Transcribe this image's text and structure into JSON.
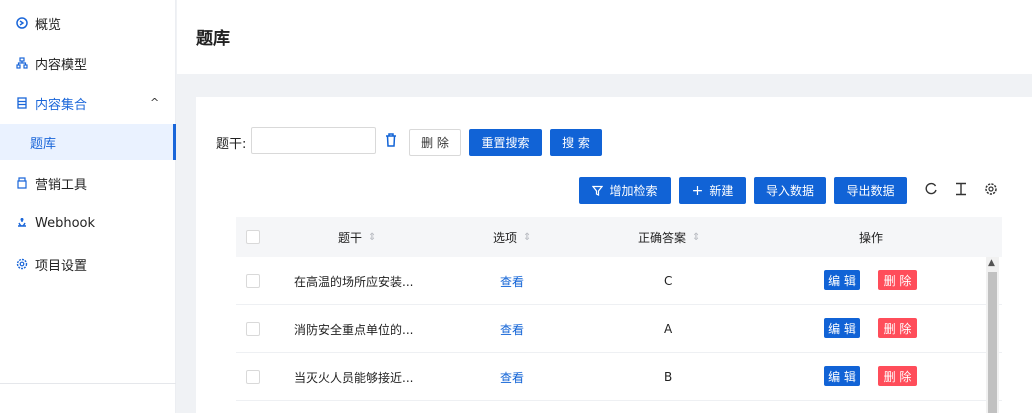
{
  "sidebar": {
    "items": [
      {
        "label": "概览",
        "icon": "overview-icon"
      },
      {
        "label": "内容模型",
        "icon": "model-icon"
      },
      {
        "label": "内容集合",
        "icon": "collection-icon",
        "arrow": "^"
      },
      {
        "label": "题库"
      },
      {
        "label": "营销工具",
        "icon": "marketing-icon"
      },
      {
        "label": "Webhook",
        "icon": "webhook-icon"
      },
      {
        "label": "项目设置",
        "icon": "settings-icon"
      }
    ]
  },
  "header": {
    "title": "题库"
  },
  "search": {
    "label": "题干:",
    "value": "",
    "placeholder": "",
    "delete_label": "删 除",
    "reset_label": "重置搜索",
    "search_label": "搜 索"
  },
  "toolbar": {
    "add_filter_label": "增加检索",
    "new_label": "新建",
    "import_label": "导入数据",
    "export_label": "导出数据"
  },
  "table": {
    "columns": [
      "题干",
      "选项",
      "正确答案",
      "操作"
    ],
    "rows": [
      {
        "stem": "在高温的场所应安装...",
        "option": "查看",
        "answer": "C"
      },
      {
        "stem": "消防安全重点单位的...",
        "option": "查看",
        "answer": "A"
      },
      {
        "stem": "当灭火人员能够接近...",
        "option": "查看",
        "answer": "B"
      }
    ],
    "edit_label": "编 辑",
    "delete_label": "删 除"
  },
  "colors": {
    "primary": "#1163d6",
    "danger": "#ff4d5a",
    "active_bg": "#eaf2ff"
  }
}
